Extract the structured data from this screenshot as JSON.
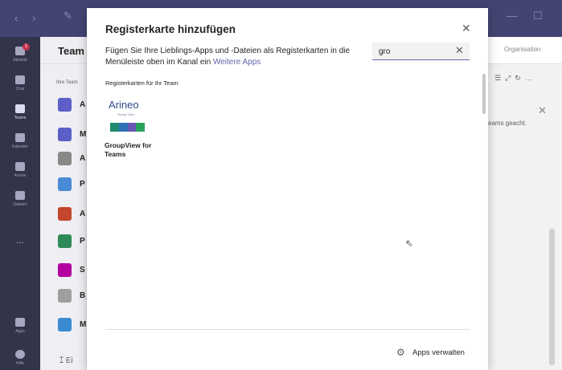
{
  "titlebar": {
    "back": "‹",
    "forward": "›",
    "minimize": "—",
    "maximize": "☐"
  },
  "rail": {
    "items": [
      {
        "label": "Aktivität",
        "badge": "1"
      },
      {
        "label": "Chat",
        "badge": ""
      },
      {
        "label": "Teams",
        "badge": ""
      },
      {
        "label": "Kalender",
        "badge": ""
      },
      {
        "label": "Anrufe",
        "badge": ""
      },
      {
        "label": "Dateien",
        "badge": ""
      },
      {
        "label": "...",
        "badge": ""
      },
      {
        "label": "Apps",
        "badge": ""
      },
      {
        "label": "Hilfe",
        "badge": ""
      }
    ]
  },
  "teams_panel": {
    "title": "Team",
    "subtitle": "Ihre Team",
    "teams": [
      {
        "initial": "A",
        "color": "#5b5fc7"
      },
      {
        "initial": "M",
        "color": "#5b5fc7"
      },
      {
        "initial": "A",
        "color": "#8a8886"
      },
      {
        "initial": "P",
        "color": "#4a8bd6"
      },
      {
        "initial": "A",
        "color": "#c4462c"
      },
      {
        "initial": "P",
        "color": "#2e8b57"
      },
      {
        "initial": "S",
        "color": "#b4009e"
      },
      {
        "initial": "B",
        "color": "#a19f9d"
      },
      {
        "initial": "M",
        "color": "#3a8ad0"
      }
    ],
    "create_label": "Ei"
  },
  "background_right": {
    "org_label": "Organisation",
    "content_text": "eams geacht."
  },
  "modal": {
    "title": "Registerkarte hinzufügen",
    "description": "Fügen Sie Ihre Lieblings-Apps und -Dateien als Registerkarten in die Menüleiste oben im Kanal ein",
    "more_apps_link": "Weitere Apps",
    "search": {
      "value": "gro",
      "placeholder": ""
    },
    "section_label": "Registerkarten für Ihr Team",
    "apps": [
      {
        "logo_text": "Arineo",
        "logo_sub": "Group View",
        "name": "GroupView for Teams"
      }
    ],
    "manage_apps": "Apps verwalten"
  },
  "colors": {
    "accent": "#6264a7",
    "titlebar": "#434473",
    "rail": "#33344a",
    "logo_bar": [
      "#1f8a70",
      "#2e6fb8",
      "#6a55b5",
      "#2aa15a"
    ]
  }
}
